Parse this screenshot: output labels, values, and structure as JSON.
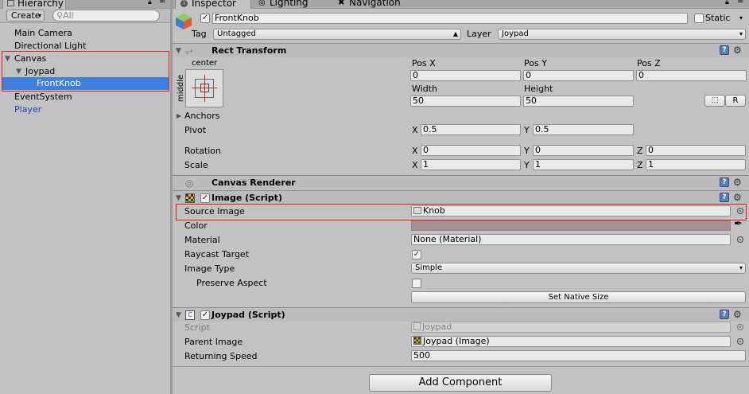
{
  "hierarchy": {
    "tab_label": "Hierarchy",
    "create_label": "Create",
    "search_placeholder": "All",
    "items": [
      {
        "label": "Main Camera"
      },
      {
        "label": "Directional Light"
      },
      {
        "label": "Canvas"
      },
      {
        "label": "Joypad"
      },
      {
        "label": "FrontKnob"
      },
      {
        "label": "EventSystem"
      },
      {
        "label": "Player"
      }
    ]
  },
  "tabs": [
    {
      "label": "Inspector"
    },
    {
      "label": "Lighting"
    },
    {
      "label": "Navigation"
    }
  ],
  "object": {
    "name": "FrontKnob",
    "static_label": "Static",
    "tag_label": "Tag",
    "tag_value": "Untagged",
    "layer_label": "Layer",
    "layer_value": "Joypad"
  },
  "rect_transform": {
    "title": "Rect Transform",
    "anchor_h": "center",
    "anchor_v": "middle",
    "posx_label": "Pos X",
    "posy_label": "Pos Y",
    "posz_label": "Pos Z",
    "posx": "0",
    "posy": "0",
    "posz": "0",
    "width_label": "Width",
    "height_label": "Height",
    "width": "50",
    "height": "50",
    "r_label": "R",
    "anchors_label": "Anchors",
    "pivot_label": "Pivot",
    "pivot_x": "0.5",
    "pivot_y": "0.5",
    "rotation_label": "Rotation",
    "rot_x": "0",
    "rot_y": "0",
    "rot_z": "0",
    "scale_label": "Scale",
    "scale_x": "1",
    "scale_y": "1",
    "scale_z": "1",
    "x": "X",
    "y": "Y",
    "z": "Z"
  },
  "canvas_renderer": {
    "title": "Canvas Renderer"
  },
  "image_script": {
    "title": "Image (Script)",
    "source_label": "Source Image",
    "source_value": "Knob",
    "color_label": "Color",
    "color_value": "#a88f8f",
    "material_label": "Material",
    "material_value": "None (Material)",
    "raycast_label": "Raycast Target",
    "image_type_label": "Image Type",
    "image_type_value": "Simple",
    "preserve_label": "Preserve Aspect",
    "native_size_label": "Set Native Size"
  },
  "joypad_script": {
    "title": "Joypad (Script)",
    "script_label": "Script",
    "script_value": "Joypad",
    "parent_label": "Parent Image",
    "parent_value": "Joypad (Image)",
    "speed_label": "Returning Speed",
    "speed_value": "500"
  },
  "add_component_label": "Add Component",
  "colors": {
    "selection": "#3d80df",
    "highlight": "#e02020",
    "player_text": "#1f3fae"
  }
}
